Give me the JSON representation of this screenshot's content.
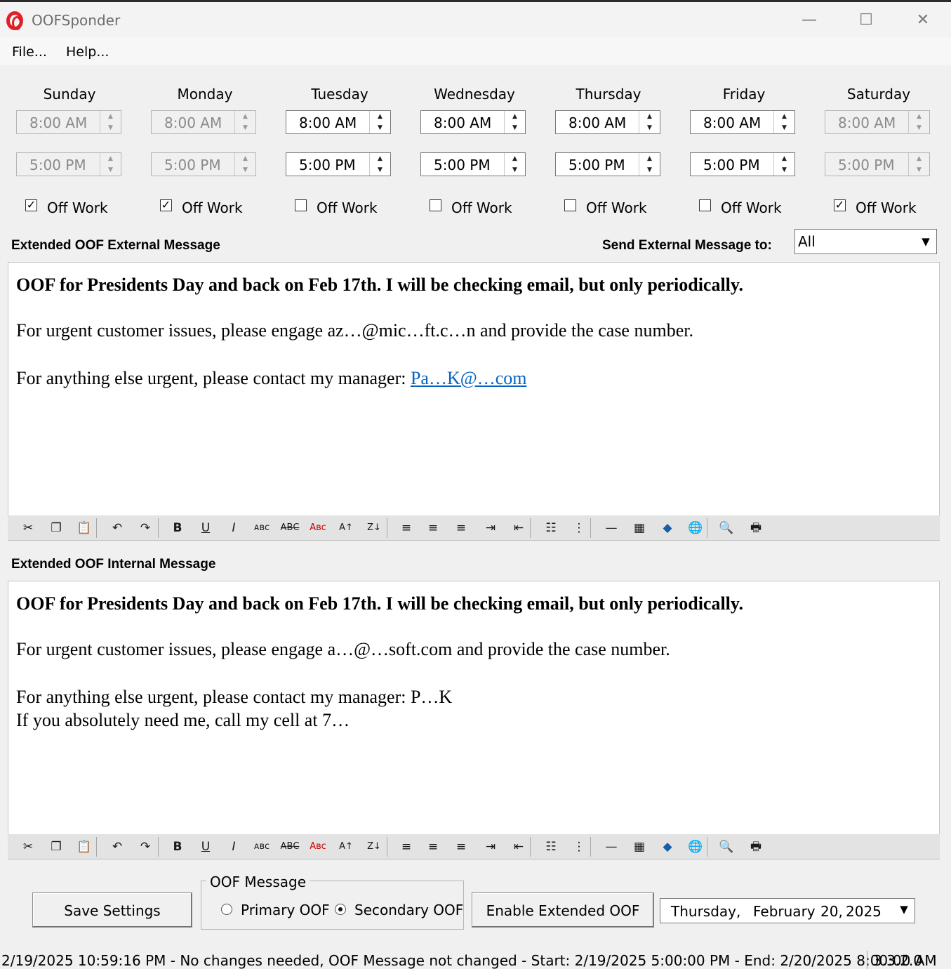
{
  "window": {
    "title": "OOFSponder",
    "minimize": "—",
    "maximize": "☐",
    "close": "✕"
  },
  "menu": [
    {
      "label": "File..."
    },
    {
      "label": "Help..."
    }
  ],
  "days": [
    {
      "name": "Sunday",
      "start": "8:00 AM",
      "end": "5:00 PM",
      "off_work_label": "Off Work",
      "off_work": true,
      "enabled": false
    },
    {
      "name": "Monday",
      "start": "8:00 AM",
      "end": "5:00 PM",
      "off_work_label": "Off Work",
      "off_work": true,
      "enabled": false
    },
    {
      "name": "Tuesday",
      "start": "8:00 AM",
      "end": "5:00 PM",
      "off_work_label": "Off Work",
      "off_work": false,
      "enabled": true
    },
    {
      "name": "Wednesday",
      "start": "8:00 AM",
      "end": "5:00 PM",
      "off_work_label": "Off Work",
      "off_work": false,
      "enabled": true
    },
    {
      "name": "Thursday",
      "start": "8:00 AM",
      "end": "5:00 PM",
      "off_work_label": "Off Work",
      "off_work": false,
      "enabled": true
    },
    {
      "name": "Friday",
      "start": "8:00 AM",
      "end": "5:00 PM",
      "off_work_label": "Off Work",
      "off_work": false,
      "enabled": true
    },
    {
      "name": "Saturday",
      "start": "8:00 AM",
      "end": "5:00 PM",
      "off_work_label": "Off Work",
      "off_work": true,
      "enabled": false
    }
  ],
  "external": {
    "label": "Extended OOF External Message",
    "send_to_label": "Send External Message to:",
    "send_to_value": "All",
    "line1": "OOF for Presidents Day and back on Feb 17th.  I will be checking email, but only periodically.",
    "line2": "For urgent customer issues, please engage az…@mic…ft.c…n and provide the case number.",
    "line3_prefix": "For anything else urgent, please contact my manager: ",
    "line3_link": "Pa…K@…com"
  },
  "internal": {
    "label": "Extended OOF Internal Message",
    "line1": "OOF for Presidents Day and back on Feb 17th.  I will be checking email, but only periodically.",
    "line2": "For urgent customer issues, please engage a…@…soft.com and provide the case number.",
    "line3": "For anything else urgent, please contact my manager: P…K",
    "line4": "If you absolutely need me, call my cell at 7…"
  },
  "toolbar_icons": [
    {
      "name": "cut-icon",
      "glyph": "✂"
    },
    {
      "name": "copy-icon",
      "glyph": "❐"
    },
    {
      "name": "paste-icon",
      "glyph": "📋"
    },
    {
      "name": "undo-icon",
      "glyph": "↶"
    },
    {
      "name": "redo-icon",
      "glyph": "↷"
    },
    {
      "name": "bold-icon",
      "glyph": "B"
    },
    {
      "name": "underline-icon",
      "glyph": "U"
    },
    {
      "name": "italic-icon",
      "glyph": "I"
    },
    {
      "name": "spellcheck-icon",
      "glyph": "ᴀʙᴄ"
    },
    {
      "name": "strikethrough-icon",
      "glyph": "A̶B̶C̶"
    },
    {
      "name": "font-color-icon",
      "glyph": "Aʙᴄ"
    },
    {
      "name": "grow-font-icon",
      "glyph": "A↑"
    },
    {
      "name": "shrink-font-icon",
      "glyph": "Z↓"
    },
    {
      "name": "align-left-icon",
      "glyph": "≡"
    },
    {
      "name": "align-center-icon",
      "glyph": "≡"
    },
    {
      "name": "align-right-icon",
      "glyph": "≡"
    },
    {
      "name": "indent-icon",
      "glyph": "⇥"
    },
    {
      "name": "outdent-icon",
      "glyph": "⇤"
    },
    {
      "name": "bullet-list-icon",
      "glyph": "☷"
    },
    {
      "name": "numbered-list-icon",
      "glyph": "⋮"
    },
    {
      "name": "horizontal-rule-icon",
      "glyph": "—"
    },
    {
      "name": "table-icon",
      "glyph": "▦"
    },
    {
      "name": "image-icon",
      "glyph": "◆"
    },
    {
      "name": "hyperlink-icon",
      "glyph": "🌐"
    },
    {
      "name": "find-icon",
      "glyph": "🔍"
    },
    {
      "name": "print-icon",
      "glyph": "🖶"
    }
  ],
  "bottom": {
    "save_label": "Save Settings",
    "group_title": "OOF Message",
    "primary_label": "Primary OOF",
    "secondary_label": "Secondary OOF",
    "selected": "secondary",
    "enable_label": "Enable Extended OOF",
    "date_weekday": "Thursday",
    "date_comma1": ",",
    "date_month": "February",
    "date_day": "20,",
    "date_year": "2025"
  },
  "status": {
    "text": "2/19/2025 10:59:16 PM - No changes needed, OOF Message not changed - Start: 2/19/2025 5:00:00 PM - End: 2/20/2025 8:00:00 AM",
    "version": "3.3.2.0"
  }
}
